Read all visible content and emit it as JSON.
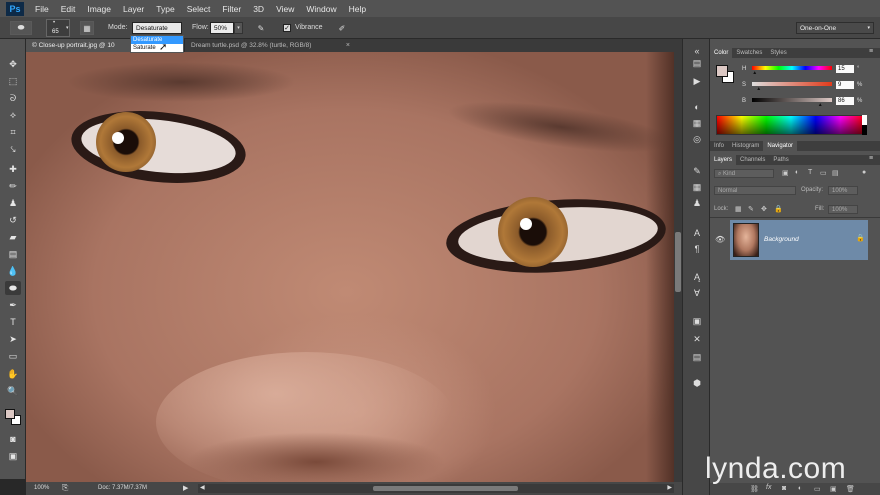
{
  "app": {
    "logo": "Ps"
  },
  "menu": [
    "File",
    "Edit",
    "Image",
    "Layer",
    "Type",
    "Select",
    "Filter",
    "3D",
    "View",
    "Window",
    "Help"
  ],
  "options": {
    "brush_size": "65",
    "mode_label": "Mode:",
    "mode_value": "Desaturate",
    "flow_label": "Flow:",
    "flow_value": "50%",
    "vibrance_label": "Vibrance",
    "workspace": "One-on-One"
  },
  "mode_dropdown": {
    "options": [
      "Desaturate",
      "Saturate"
    ],
    "selected": "Desaturate"
  },
  "tabs": [
    {
      "label": "© Close-up portrait.jpg @ 10",
      "active": true
    },
    {
      "label": "Dream turtle.psd @ 32.8% (turtle, RGB/8)",
      "active": false
    }
  ],
  "status": {
    "zoom": "100%",
    "doc": "Doc: 7.37M/7.37M"
  },
  "color_panel": {
    "tabs": [
      "Color",
      "Swatches",
      "Styles"
    ],
    "h": "15",
    "s": "9",
    "b": "86",
    "h_label": "H",
    "s_label": "S",
    "b_label": "B",
    "unit_deg": "°",
    "unit_pct": "%",
    "h_level": 0.04,
    "s_level": 0.09,
    "b_level": 0.86,
    "foreground": "#dcc8c4"
  },
  "info_tabs": [
    "Info",
    "Histogram",
    "Navigator"
  ],
  "layers_panel": {
    "tabs": [
      "Layers",
      "Channels",
      "Paths"
    ],
    "filter": "Kind",
    "blend_mode": "Normal",
    "opacity_label": "Opacity:",
    "opacity_value": "100%",
    "lock_label": "Lock:",
    "fill_label": "Fill:",
    "fill_value": "100%",
    "layer_name": "Background"
  },
  "brand": "lynda.com"
}
